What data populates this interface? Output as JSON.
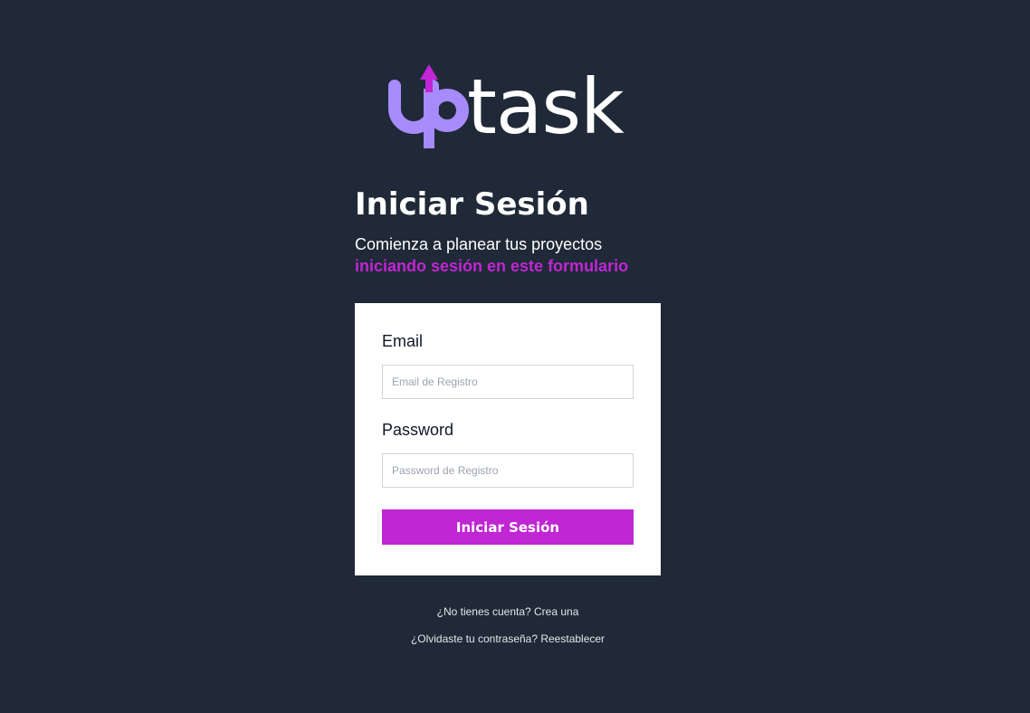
{
  "brand": {
    "logo_text": "task",
    "logo_icon": "up-arrow-logo-icon",
    "accent_color": "#a78bfa",
    "arrow_color": "#c026d3"
  },
  "header": {
    "title": "Iniciar Sesión",
    "subtitle_line1": "Comienza a planear tus proyectos",
    "subtitle_line2": "iniciando sesión en este formulario"
  },
  "form": {
    "email": {
      "label": "Email",
      "placeholder": "Email de Registro",
      "value": ""
    },
    "password": {
      "label": "Password",
      "placeholder": "Password de Registro",
      "value": ""
    },
    "submit_label": "Iniciar Sesión"
  },
  "footer": {
    "register_link": "¿No tienes cuenta? Crea una",
    "reset_link": "¿Olvidaste tu contraseña? Reestablecer"
  },
  "colors": {
    "background": "#1f2937",
    "primary": "#c026d3"
  }
}
